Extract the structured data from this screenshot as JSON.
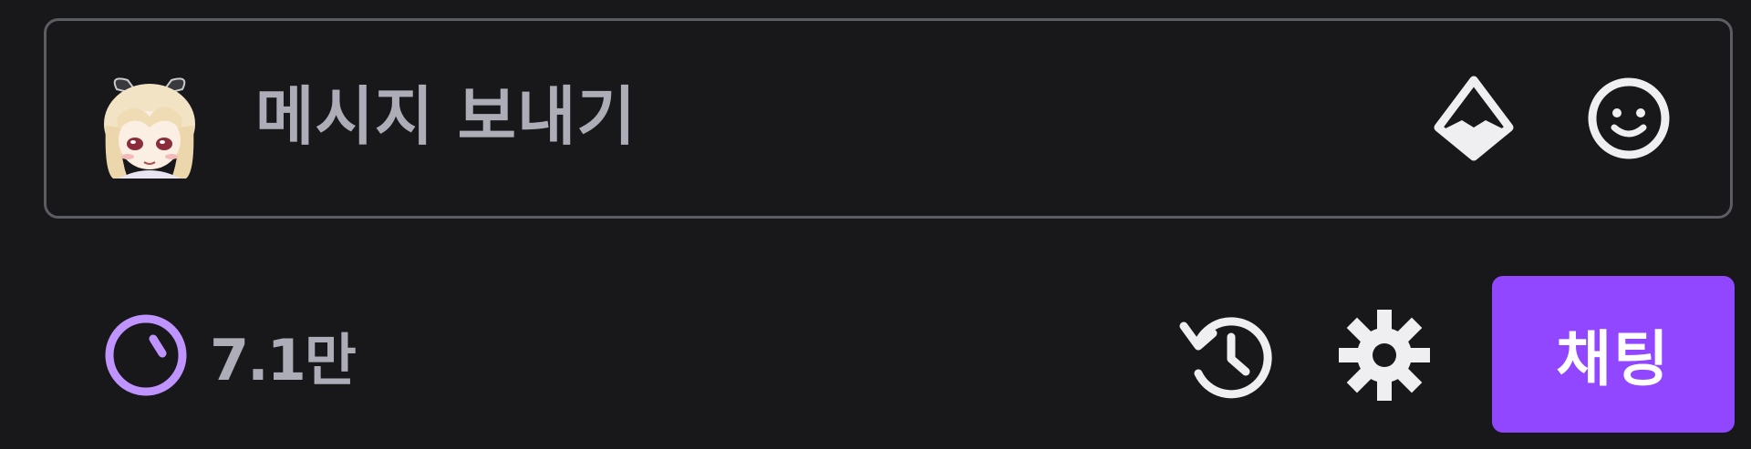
{
  "input": {
    "placeholder": "메시지 보내기"
  },
  "icons": {
    "avatar": "user-avatar-emote",
    "bits": "bits-diamond-icon",
    "emote": "smiley-face-icon",
    "points": "channel-points-icon",
    "history": "history-icon",
    "settings": "gear-icon"
  },
  "points": {
    "label": "7.1만"
  },
  "actions": {
    "chat_label": "채팅"
  },
  "colors": {
    "background": "#18181b",
    "accent": "#9147ff",
    "points": "#bf94ff",
    "muted_text": "#adadb8",
    "icon": "#efeff1"
  }
}
